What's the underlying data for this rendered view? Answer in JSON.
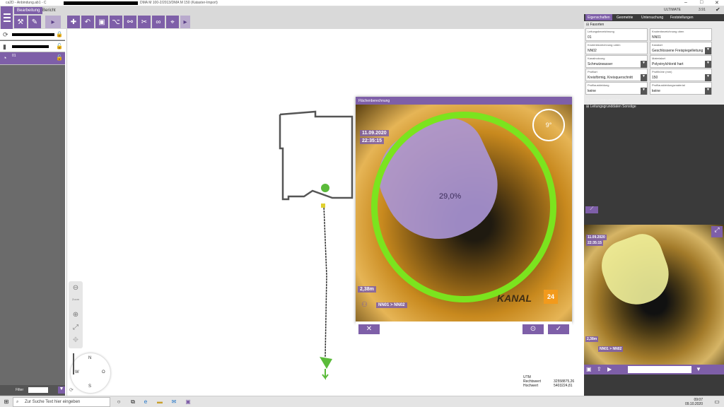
{
  "window": {
    "title_app": "ca2D - Anbindung.ab1 - C",
    "title_file": "DMA M 100-2/2013/DMA M 150 (Kataster-Import)",
    "minimize": "–",
    "maximize": "□",
    "close": "✕"
  },
  "tabs": {
    "edit": "Bearbeitung",
    "report": "Bericht"
  },
  "toolbar": {
    "more": "▸"
  },
  "layers": {
    "layer3_label": "01"
  },
  "filter": {
    "label": "Filter"
  },
  "map_controls": {
    "zoom_label": "Zoom",
    "compass": {
      "n": "N",
      "s": "S",
      "w": "W",
      "o": "O"
    }
  },
  "dialog": {
    "title": "Flächenberechnung",
    "date": "11.09.2020",
    "time": "22:35:15",
    "percent": "29,0%",
    "distance": "2,38m",
    "segment": "NN01 > NN02",
    "angle": "9°",
    "watermark": "KANAL",
    "badge": "24",
    "cancel": "✕",
    "confirm": "✓"
  },
  "right_panel": {
    "edition": "ULTIMATE",
    "version": "3.91",
    "tabs": [
      "Eigenschaften",
      "Geometrie",
      "Untersuchung",
      "Feststellungen"
    ],
    "section_main": "Fasorten",
    "fields": [
      {
        "label": "Leitungsbezeichnung",
        "value": "01"
      },
      {
        "label": "Knotenbezeichnung oben",
        "value": "NN01"
      },
      {
        "label": "Knotenbezeichnung unten",
        "value": "NN02"
      },
      {
        "label": "Kanalart",
        "value": "Geschlossene Freispiegelleitung"
      },
      {
        "label": "Kanalnutzung",
        "value": "Schmutzwasser"
      },
      {
        "label": "Materialart",
        "value": "Polyvinylchlorid hart"
      },
      {
        "label": "Profilart",
        "value": "Kreisförmig, Kreisquerschnitt"
      },
      {
        "label": "Profilhöhe (mm)",
        "value": "150"
      },
      {
        "label": "Profilauskleidung",
        "value": "keine"
      },
      {
        "label": "Profilauskleidungsmaterial",
        "value": "keine"
      }
    ],
    "section_base": "Leitungsgrunddaten",
    "section_other": "Leitungsgrunddaten Sonstige",
    "thumb_date": "11.09.2020",
    "thumb_time": "22:35:15",
    "thumb_dist": "2,38m",
    "thumb_segment": "NN01 > NN02"
  },
  "status": {
    "crs": "UTM",
    "east_label": "Rechtswert",
    "east_value": "32558875,26",
    "north_label": "Hochwert",
    "north_value": "5403224,81"
  },
  "taskbar": {
    "search_placeholder": "Zur Suche Text hier eingeben",
    "time": "09:07",
    "date": "09.10.2020"
  }
}
